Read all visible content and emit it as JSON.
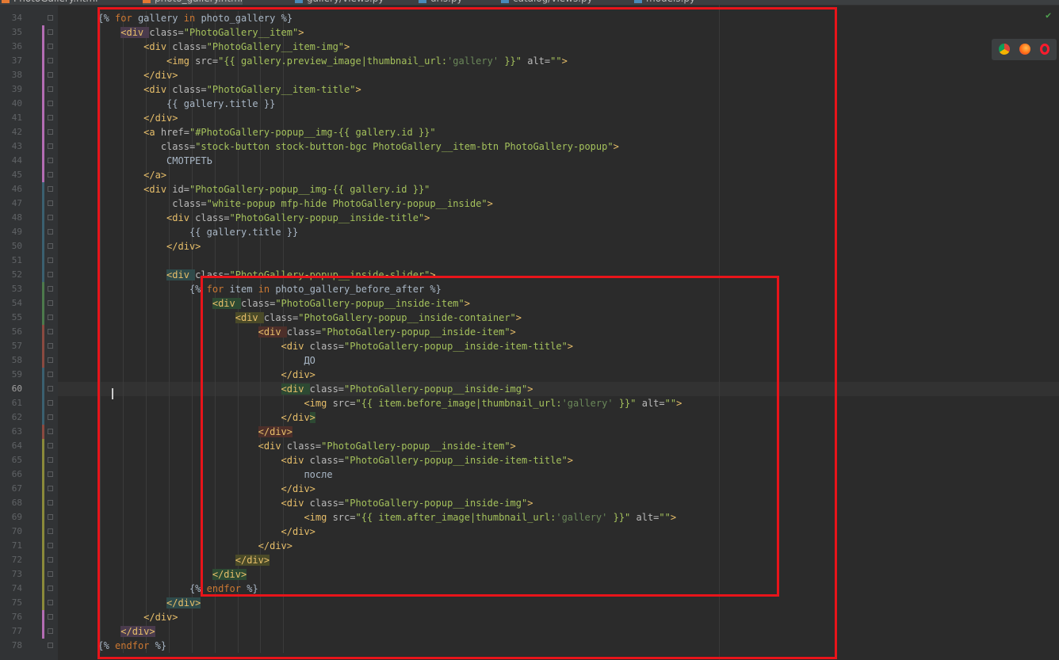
{
  "tabs": [
    {
      "label": "PhotoGallery.html",
      "active": false,
      "icon": "html-file-icon"
    },
    {
      "label": "photo_gallery.html",
      "active": true,
      "icon": "html-file-icon"
    },
    {
      "label": "gallery/views.py",
      "active": false,
      "icon": "python-file-icon"
    },
    {
      "label": "urls.py",
      "active": false,
      "icon": "python-file-icon"
    },
    {
      "label": "catalog/views.py",
      "active": false,
      "icon": "python-file-icon"
    },
    {
      "label": "models.py",
      "active": false,
      "icon": "python-file-icon"
    }
  ],
  "editor": {
    "current_line": 60,
    "lines": [
      {
        "n": 34,
        "indent": 6,
        "tokens": [
          {
            "t": "{% ",
            "c": "dj"
          },
          {
            "t": "for",
            "c": "kw"
          },
          {
            "t": " gallery ",
            "c": "dj"
          },
          {
            "t": "in",
            "c": "kw"
          },
          {
            "t": " photo_gallery %}",
            "c": "dj"
          }
        ]
      },
      {
        "n": 35,
        "indent": 10,
        "tokens": [
          {
            "t": "<div ",
            "c": "tg hl-purple"
          },
          {
            "t": "class=",
            "c": "at"
          },
          {
            "t": "\"PhotoGallery__item\"",
            "c": "av"
          },
          {
            "t": ">",
            "c": "tg"
          }
        ]
      },
      {
        "n": 36,
        "indent": 14,
        "tokens": [
          {
            "t": "<div ",
            "c": "tg"
          },
          {
            "t": "class=",
            "c": "at"
          },
          {
            "t": "\"PhotoGallery__item-img\"",
            "c": "av"
          },
          {
            "t": ">",
            "c": "tg"
          }
        ]
      },
      {
        "n": 37,
        "indent": 18,
        "tokens": [
          {
            "t": "<img ",
            "c": "tg"
          },
          {
            "t": "src=",
            "c": "at"
          },
          {
            "t": "\"{{ gallery.preview_image|thumbnail_url:",
            "c": "av"
          },
          {
            "t": "'gallery'",
            "c": "st"
          },
          {
            "t": " }}\"",
            "c": "av"
          },
          {
            "t": " alt=",
            "c": "at"
          },
          {
            "t": "\"\"",
            "c": "av"
          },
          {
            "t": ">",
            "c": "tg"
          }
        ]
      },
      {
        "n": 38,
        "indent": 14,
        "tokens": [
          {
            "t": "</div>",
            "c": "tg"
          }
        ]
      },
      {
        "n": 39,
        "indent": 14,
        "tokens": [
          {
            "t": "<div ",
            "c": "tg"
          },
          {
            "t": "class=",
            "c": "at"
          },
          {
            "t": "\"PhotoGallery__item-title\"",
            "c": "av"
          },
          {
            "t": ">",
            "c": "tg"
          }
        ]
      },
      {
        "n": 40,
        "indent": 18,
        "tokens": [
          {
            "t": "{{ gallery.title }}",
            "c": "dj"
          }
        ]
      },
      {
        "n": 41,
        "indent": 14,
        "tokens": [
          {
            "t": "</div>",
            "c": "tg"
          }
        ]
      },
      {
        "n": 42,
        "indent": 14,
        "tokens": [
          {
            "t": "<a ",
            "c": "tg"
          },
          {
            "t": "href=",
            "c": "at"
          },
          {
            "t": "\"#PhotoGallery-popup__img-{{ gallery.id }}\"",
            "c": "av"
          }
        ]
      },
      {
        "n": 43,
        "indent": 17,
        "tokens": [
          {
            "t": "class=",
            "c": "at"
          },
          {
            "t": "\"stock-button stock-button-bgc PhotoGallery__item-btn PhotoGallery-popup\"",
            "c": "av"
          },
          {
            "t": ">",
            "c": "tg"
          }
        ]
      },
      {
        "n": 44,
        "indent": 18,
        "tokens": [
          {
            "t": "СМОТРЕТЬ",
            "c": "tx"
          }
        ]
      },
      {
        "n": 45,
        "indent": 14,
        "tokens": [
          {
            "t": "</a>",
            "c": "tg"
          }
        ]
      },
      {
        "n": 46,
        "indent": 14,
        "tokens": [
          {
            "t": "<div ",
            "c": "tg"
          },
          {
            "t": "id=",
            "c": "at"
          },
          {
            "t": "\"PhotoGallery-popup__img-{{ gallery.id }}\"",
            "c": "av"
          }
        ]
      },
      {
        "n": 47,
        "indent": 19,
        "tokens": [
          {
            "t": "class=",
            "c": "at"
          },
          {
            "t": "\"white-popup mfp-hide PhotoGallery-popup__inside\"",
            "c": "av"
          },
          {
            "t": ">",
            "c": "tg"
          }
        ]
      },
      {
        "n": 48,
        "indent": 18,
        "tokens": [
          {
            "t": "<div ",
            "c": "tg"
          },
          {
            "t": "class=",
            "c": "at"
          },
          {
            "t": "\"PhotoGallery-popup__inside-title\"",
            "c": "av"
          },
          {
            "t": ">",
            "c": "tg"
          }
        ]
      },
      {
        "n": 49,
        "indent": 22,
        "tokens": [
          {
            "t": "{{ gallery.title }}",
            "c": "dj"
          }
        ]
      },
      {
        "n": 50,
        "indent": 18,
        "tokens": [
          {
            "t": "</div>",
            "c": "tg"
          }
        ]
      },
      {
        "n": 51,
        "indent": 0,
        "tokens": []
      },
      {
        "n": 52,
        "indent": 18,
        "tokens": [
          {
            "t": "<div ",
            "c": "tg hl-teal"
          },
          {
            "t": "class=",
            "c": "at"
          },
          {
            "t": "\"PhotoGallery-popup__inside-slider\"",
            "c": "av"
          },
          {
            "t": ">",
            "c": "tg"
          }
        ]
      },
      {
        "n": 53,
        "indent": 22,
        "tokens": [
          {
            "t": "{% ",
            "c": "dj"
          },
          {
            "t": "for",
            "c": "kw"
          },
          {
            "t": " item ",
            "c": "dj"
          },
          {
            "t": "in",
            "c": "kw"
          },
          {
            "t": " photo_gallery_before_after %}",
            "c": "dj"
          }
        ]
      },
      {
        "n": 54,
        "indent": 26,
        "tokens": [
          {
            "t": "<div ",
            "c": "tg hl-green"
          },
          {
            "t": "class=",
            "c": "at"
          },
          {
            "t": "\"PhotoGallery-popup__inside-item\"",
            "c": "av"
          },
          {
            "t": ">",
            "c": "tg"
          }
        ]
      },
      {
        "n": 55,
        "indent": 30,
        "tokens": [
          {
            "t": "<div ",
            "c": "tg hl-olive"
          },
          {
            "t": "class=",
            "c": "at"
          },
          {
            "t": "\"PhotoGallery-popup__inside-container\"",
            "c": "av"
          },
          {
            "t": ">",
            "c": "tg"
          }
        ]
      },
      {
        "n": 56,
        "indent": 34,
        "tokens": [
          {
            "t": "<div ",
            "c": "tg hl-red"
          },
          {
            "t": "class=",
            "c": "at"
          },
          {
            "t": "\"PhotoGallery-popup__inside-item\"",
            "c": "av"
          },
          {
            "t": ">",
            "c": "tg"
          }
        ]
      },
      {
        "n": 57,
        "indent": 38,
        "tokens": [
          {
            "t": "<div ",
            "c": "tg"
          },
          {
            "t": "class=",
            "c": "at"
          },
          {
            "t": "\"PhotoGallery-popup__inside-item-title\"",
            "c": "av"
          },
          {
            "t": ">",
            "c": "tg"
          }
        ]
      },
      {
        "n": 58,
        "indent": 42,
        "tokens": [
          {
            "t": "ДО",
            "c": "tx"
          }
        ]
      },
      {
        "n": 59,
        "indent": 38,
        "tokens": [
          {
            "t": "</div>",
            "c": "tg"
          }
        ]
      },
      {
        "n": 60,
        "indent": 38,
        "tokens": [
          {
            "t": "<div ",
            "c": "tg hl-green"
          },
          {
            "t": "class=",
            "c": "at"
          },
          {
            "t": "\"PhotoGallery-popup__inside-img\"",
            "c": "av"
          },
          {
            "t": ">",
            "c": "tg"
          }
        ]
      },
      {
        "n": 61,
        "indent": 42,
        "tokens": [
          {
            "t": "<img ",
            "c": "tg"
          },
          {
            "t": "src=",
            "c": "at"
          },
          {
            "t": "\"{{ item.before_image|thumbnail_url:",
            "c": "av"
          },
          {
            "t": "'gallery'",
            "c": "st"
          },
          {
            "t": " }}\"",
            "c": "av"
          },
          {
            "t": " alt=",
            "c": "at"
          },
          {
            "t": "\"\"",
            "c": "av"
          },
          {
            "t": ">",
            "c": "tg"
          }
        ]
      },
      {
        "n": 62,
        "indent": 38,
        "tokens": [
          {
            "t": "</div",
            "c": "tg"
          },
          {
            "t": ">",
            "c": "tg hl-green"
          }
        ]
      },
      {
        "n": 63,
        "indent": 34,
        "tokens": [
          {
            "t": "</div>",
            "c": "tg hl-red"
          }
        ]
      },
      {
        "n": 64,
        "indent": 34,
        "tokens": [
          {
            "t": "<div ",
            "c": "tg"
          },
          {
            "t": "class=",
            "c": "at"
          },
          {
            "t": "\"PhotoGallery-popup__inside-item\"",
            "c": "av"
          },
          {
            "t": ">",
            "c": "tg"
          }
        ]
      },
      {
        "n": 65,
        "indent": 38,
        "tokens": [
          {
            "t": "<div ",
            "c": "tg"
          },
          {
            "t": "class=",
            "c": "at"
          },
          {
            "t": "\"PhotoGallery-popup__inside-item-title\"",
            "c": "av"
          },
          {
            "t": ">",
            "c": "tg"
          }
        ]
      },
      {
        "n": 66,
        "indent": 42,
        "tokens": [
          {
            "t": "после",
            "c": "tx"
          }
        ]
      },
      {
        "n": 67,
        "indent": 38,
        "tokens": [
          {
            "t": "</div>",
            "c": "tg"
          }
        ]
      },
      {
        "n": 68,
        "indent": 38,
        "tokens": [
          {
            "t": "<div ",
            "c": "tg"
          },
          {
            "t": "class=",
            "c": "at"
          },
          {
            "t": "\"PhotoGallery-popup__inside-img\"",
            "c": "av"
          },
          {
            "t": ">",
            "c": "tg"
          }
        ]
      },
      {
        "n": 69,
        "indent": 42,
        "tokens": [
          {
            "t": "<img ",
            "c": "tg"
          },
          {
            "t": "src=",
            "c": "at"
          },
          {
            "t": "\"{{ item.after_image|thumbnail_url:",
            "c": "av"
          },
          {
            "t": "'gallery'",
            "c": "st"
          },
          {
            "t": " }}\"",
            "c": "av"
          },
          {
            "t": " alt=",
            "c": "at"
          },
          {
            "t": "\"\"",
            "c": "av"
          },
          {
            "t": ">",
            "c": "tg"
          }
        ]
      },
      {
        "n": 70,
        "indent": 38,
        "tokens": [
          {
            "t": "</div>",
            "c": "tg"
          }
        ]
      },
      {
        "n": 71,
        "indent": 34,
        "tokens": [
          {
            "t": "</div>",
            "c": "tg"
          }
        ]
      },
      {
        "n": 72,
        "indent": 30,
        "tokens": [
          {
            "t": "</div>",
            "c": "tg hl-olive"
          }
        ]
      },
      {
        "n": 73,
        "indent": 26,
        "tokens": [
          {
            "t": "</div>",
            "c": "tg hl-green"
          }
        ]
      },
      {
        "n": 74,
        "indent": 22,
        "tokens": [
          {
            "t": "{% ",
            "c": "dj"
          },
          {
            "t": "endfor",
            "c": "kw"
          },
          {
            "t": " %}",
            "c": "dj"
          }
        ]
      },
      {
        "n": 75,
        "indent": 18,
        "tokens": [
          {
            "t": "</div>",
            "c": "tg hl-teal"
          }
        ]
      },
      {
        "n": 76,
        "indent": 14,
        "tokens": [
          {
            "t": "</div>",
            "c": "tg"
          }
        ]
      },
      {
        "n": 77,
        "indent": 10,
        "tokens": [
          {
            "t": "</div>",
            "c": "tg hl-purple"
          }
        ]
      },
      {
        "n": 78,
        "indent": 6,
        "tokens": [
          {
            "t": "{% ",
            "c": "dj"
          },
          {
            "t": "endfor",
            "c": "kw"
          },
          {
            "t": " %}",
            "c": "dj"
          }
        ]
      }
    ]
  },
  "browser_icons": [
    "chrome-icon",
    "firefox-icon",
    "opera-icon"
  ],
  "status_icon": "inspection-ok-icon",
  "colors": {
    "background": "#2b2b2b",
    "gutter": "#313335",
    "annotation_red": "#e8141a",
    "tag": "#e8bf6a",
    "attr_value": "#a5c25c",
    "keyword": "#cc7832"
  }
}
